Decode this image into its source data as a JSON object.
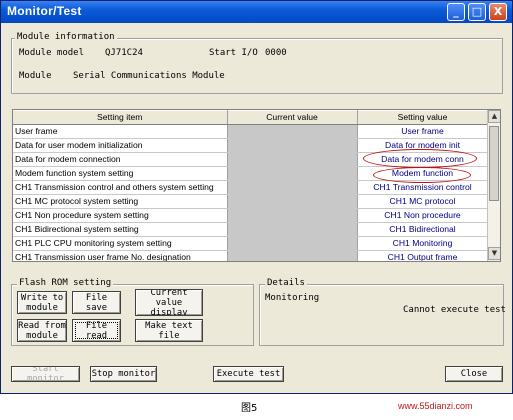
{
  "window": {
    "title": "Monitor/Test",
    "controls": [
      "_",
      "□",
      "X"
    ]
  },
  "module_info": {
    "legend": "Module information",
    "model_label": "Module model",
    "model_value": "QJ71C24",
    "start_io_label": "Start I/O",
    "start_io_value": "0000",
    "module_label": "Module",
    "module_value": "Serial Communications Module"
  },
  "table": {
    "headers": [
      "Setting item",
      "Current value",
      "Setting value"
    ],
    "rows": [
      {
        "item": "User frame",
        "current": "",
        "setting": "User frame"
      },
      {
        "item": "Data for user modem initialization",
        "current": "",
        "setting": "Data for modem init"
      },
      {
        "item": "Data for modem connection",
        "current": "",
        "setting": "Data for modem conn"
      },
      {
        "item": "Modem function system setting",
        "current": "",
        "setting": "Modem function"
      },
      {
        "item": "CH1 Transmission control and others system setting",
        "current": "",
        "setting": "CH1 Transmission control"
      },
      {
        "item": "CH1 MC protocol system setting",
        "current": "",
        "setting": "CH1 MC protocol"
      },
      {
        "item": "CH1 Non procedure system setting",
        "current": "",
        "setting": "CH1 Non procedure"
      },
      {
        "item": "CH1 Bidirectional system setting",
        "current": "",
        "setting": "CH1 Bidirectional"
      },
      {
        "item": "CH1 PLC CPU monitoring system setting",
        "current": "",
        "setting": "CH1 Monitoring"
      },
      {
        "item": "CH1 Transmission user frame No. designation",
        "current": "",
        "setting": "CH1 Output frame"
      }
    ]
  },
  "flash_rom": {
    "legend": "Flash ROM setting",
    "write_to_module": "Write to module",
    "file_save": "File save",
    "current_value_display": "Current value display",
    "read_from_module": "Read from module",
    "file_read": "File read",
    "make_text_file": "Make text file"
  },
  "details": {
    "legend": "Details",
    "status_label": "Monitoring",
    "message": "Cannot execute test"
  },
  "footer": {
    "start_monitor": "Start monitor",
    "stop_monitor": "Stop monitor",
    "execute_test": "Execute test",
    "close": "Close"
  },
  "caption": {
    "figure": "图5",
    "watermark": "www.55dianzi.com"
  },
  "colors": {
    "title_bar": "#0a5bd8",
    "annotation": "#c01010",
    "setting_text": "#000080"
  }
}
